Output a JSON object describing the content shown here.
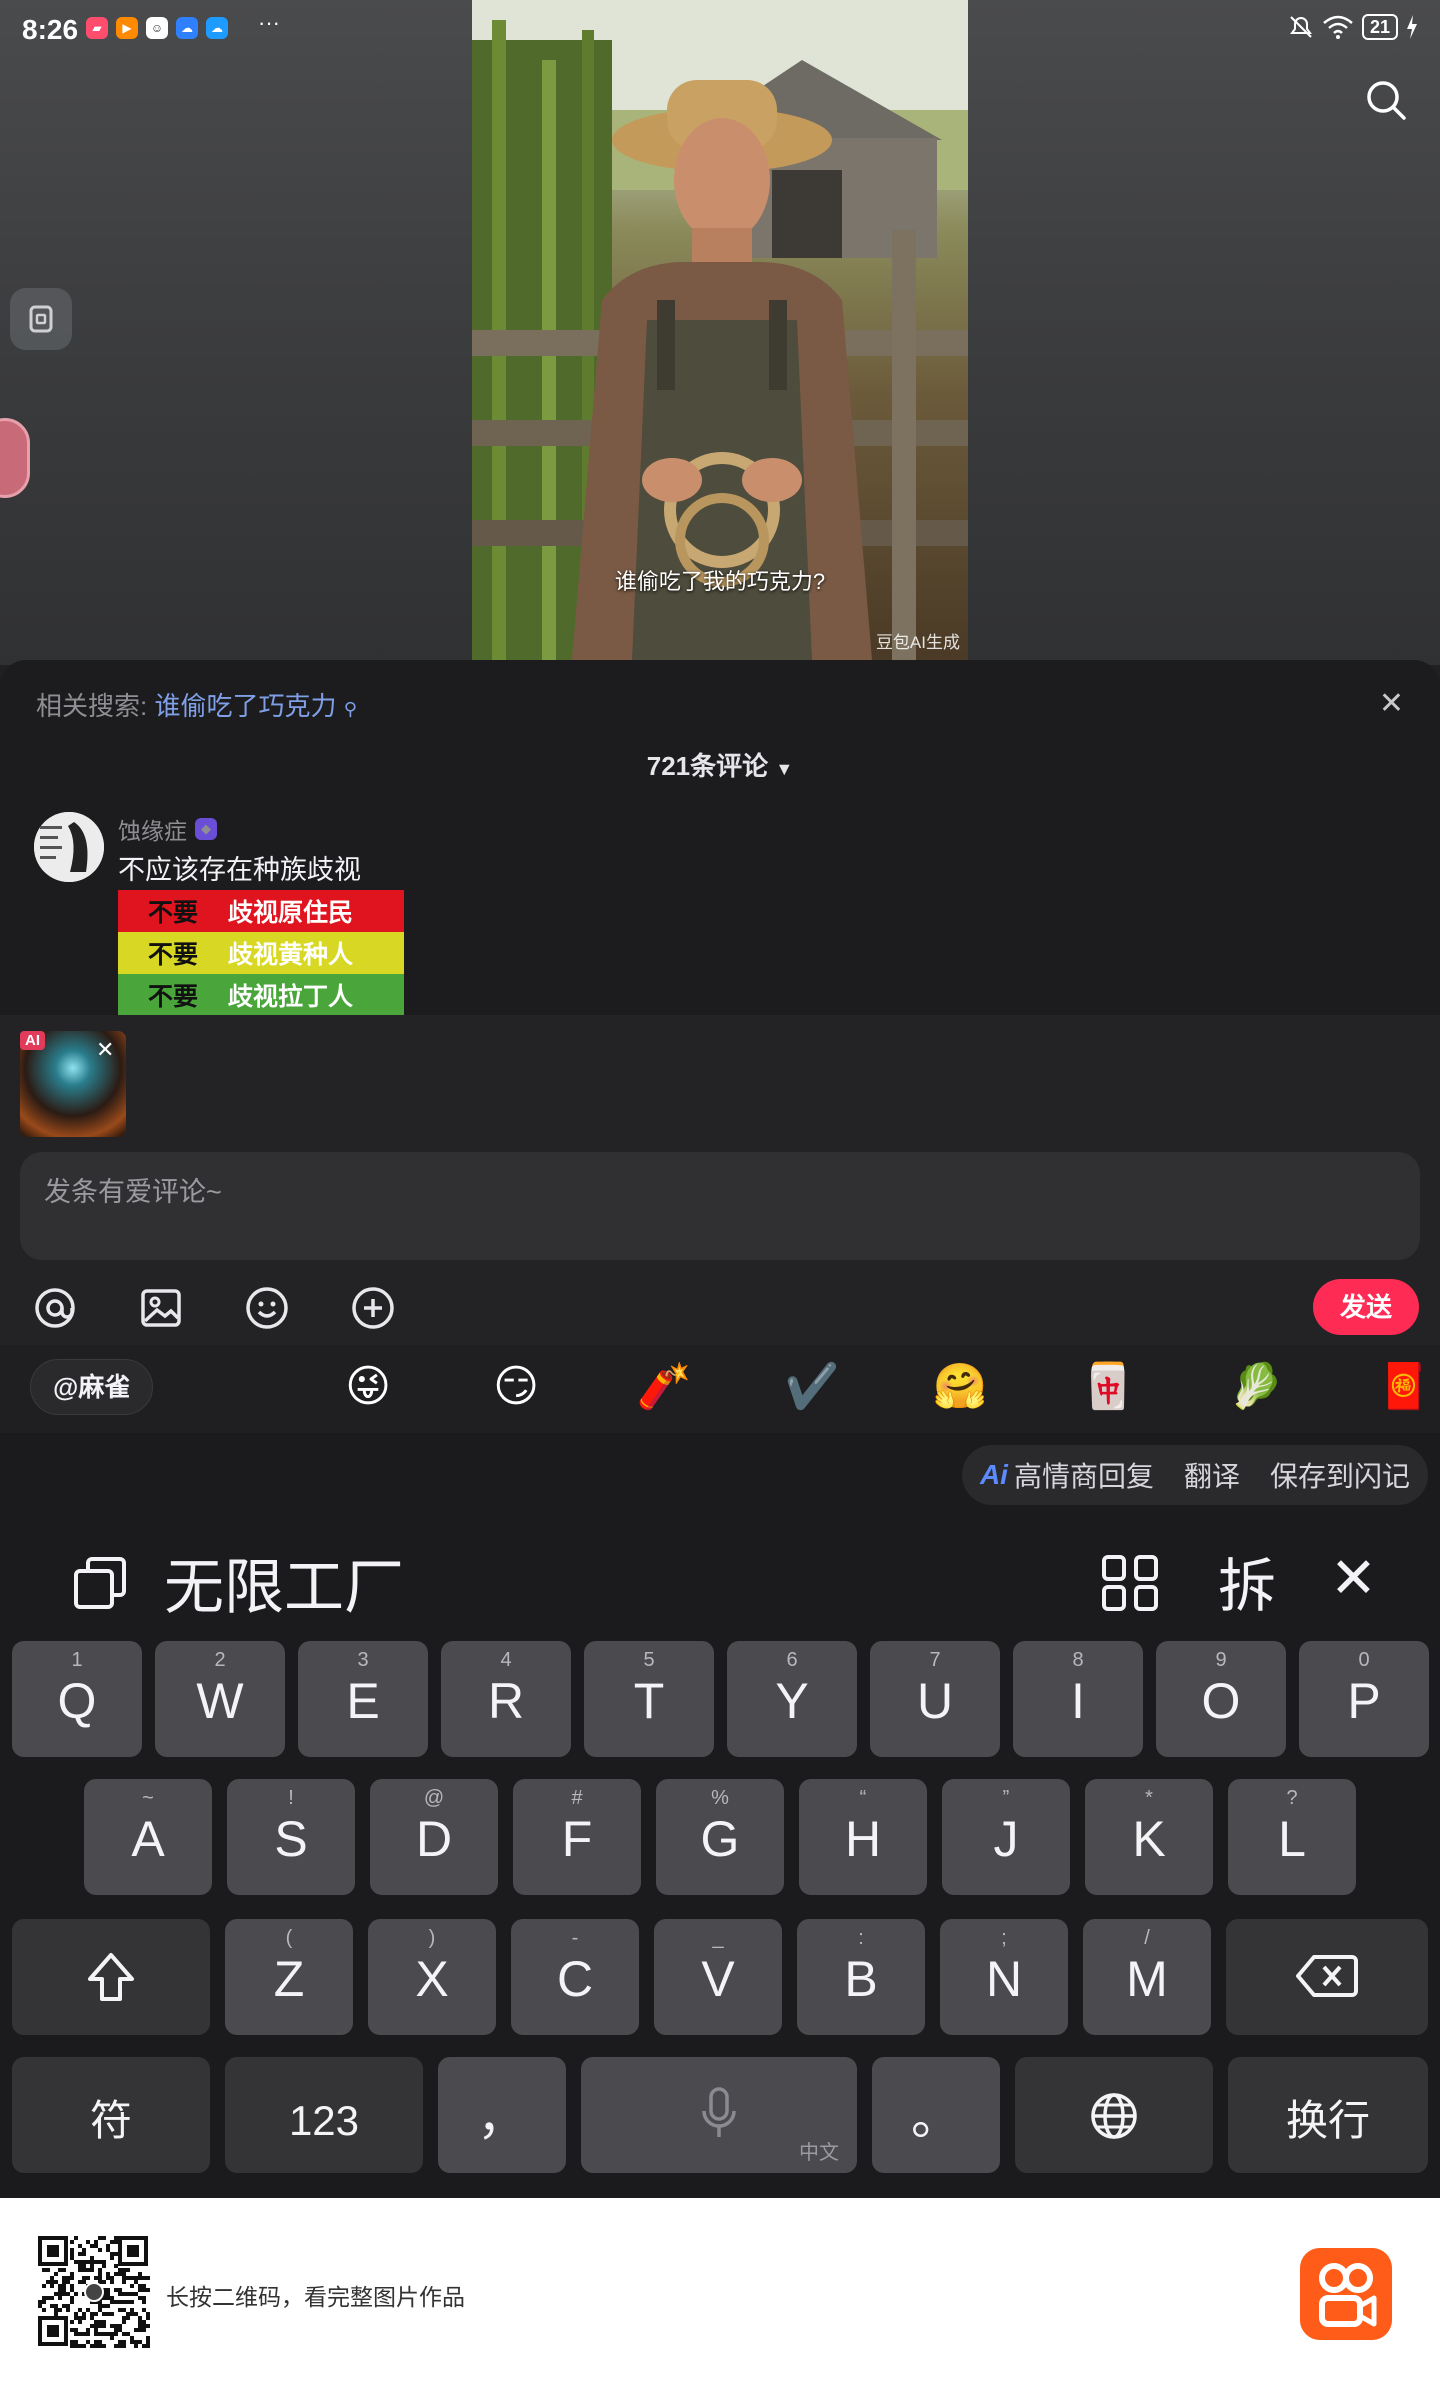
{
  "status_bar": {
    "time": "8:26",
    "battery": "21",
    "more": "···"
  },
  "video": {
    "subtitle": "谁偷吃了我的巧克力?",
    "watermark": "豆包AI生成"
  },
  "comments_panel": {
    "related_label": "相关搜索:",
    "related_query": "谁偷吃了巧克力",
    "count_label": "721条评论",
    "comment": {
      "username": "蚀缘症",
      "text": "不应该存在种族歧视",
      "image_rows": [
        {
          "neg": "不要",
          "text": "歧视原住民",
          "color": "#e0141e"
        },
        {
          "neg": "不要",
          "text": "歧视黄种人",
          "color": "#d8d824"
        },
        {
          "neg": "不要",
          "text": "歧视拉丁人",
          "color": "#4aa63a"
        }
      ]
    }
  },
  "compose": {
    "ai_badge": "AI",
    "placeholder": "发条有爱评论~",
    "send_label": "发送"
  },
  "suggestions": {
    "mention": "@麻雀",
    "emojis": [
      "😜",
      "😏",
      "🧨",
      "✔️",
      "🤗",
      "🀄",
      "🥬",
      "🧧"
    ]
  },
  "keyboard": {
    "ai_bar": {
      "ai_mark": "Ai",
      "items": [
        "高情商回复",
        "翻译",
        "保存到闪记"
      ]
    },
    "candidate": "无限工厂",
    "split_label": "拆",
    "row1": [
      {
        "k": "Q",
        "s": "1"
      },
      {
        "k": "W",
        "s": "2"
      },
      {
        "k": "E",
        "s": "3"
      },
      {
        "k": "R",
        "s": "4"
      },
      {
        "k": "T",
        "s": "5"
      },
      {
        "k": "Y",
        "s": "6"
      },
      {
        "k": "U",
        "s": "7"
      },
      {
        "k": "I",
        "s": "8"
      },
      {
        "k": "O",
        "s": "9"
      },
      {
        "k": "P",
        "s": "0"
      }
    ],
    "row2": [
      {
        "k": "A",
        "s": "~"
      },
      {
        "k": "S",
        "s": "!"
      },
      {
        "k": "D",
        "s": "@"
      },
      {
        "k": "F",
        "s": "#"
      },
      {
        "k": "G",
        "s": "%"
      },
      {
        "k": "H",
        "s": "“"
      },
      {
        "k": "J",
        "s": "”"
      },
      {
        "k": "K",
        "s": "*"
      },
      {
        "k": "L",
        "s": "?"
      }
    ],
    "row3": [
      {
        "k": "Z",
        "s": "("
      },
      {
        "k": "X",
        "s": ")"
      },
      {
        "k": "C",
        "s": "-"
      },
      {
        "k": "V",
        "s": "_"
      },
      {
        "k": "B",
        "s": ":"
      },
      {
        "k": "N",
        "s": ";"
      },
      {
        "k": "M",
        "s": "/"
      }
    ],
    "row4": {
      "symbols": "符",
      "numbers": "123",
      "comma": "，",
      "space_hint": "中文",
      "period": "。",
      "enter": "换行"
    }
  },
  "banner": {
    "text": "长按二维码，看完整图片作品"
  }
}
